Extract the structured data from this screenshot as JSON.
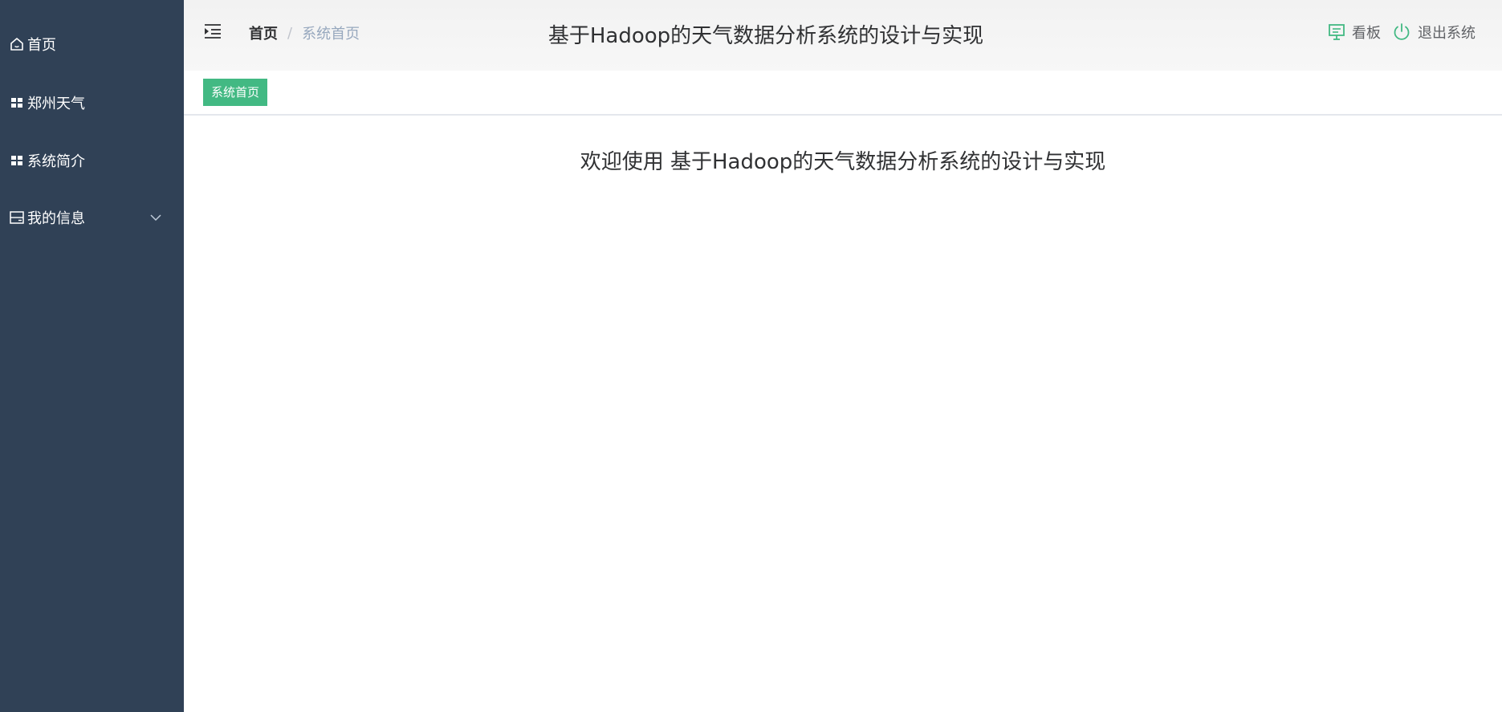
{
  "sidebar": {
    "items": [
      {
        "label": "首页",
        "icon": "home-icon"
      },
      {
        "label": "郑州天气",
        "icon": "grid-icon"
      },
      {
        "label": "系统简介",
        "icon": "grid-icon"
      },
      {
        "label": "我的信息",
        "icon": "panel-icon",
        "expandable": true
      }
    ]
  },
  "header": {
    "breadcrumb": {
      "home": "首页",
      "separator": "/",
      "current": "系统首页"
    },
    "title": "基于Hadoop的天气数据分析系统的设计与实现",
    "dashboard_label": "看板",
    "logout_label": "退出系统"
  },
  "tags": {
    "active": "系统首页"
  },
  "main": {
    "welcome": "欢迎使用 基于Hadoop的天气数据分析系统的设计与实现"
  },
  "colors": {
    "sidebar_bg": "#304156",
    "accent_green": "#42b983",
    "dashboard_icon": "#42b983",
    "logout_icon": "#42b983"
  }
}
